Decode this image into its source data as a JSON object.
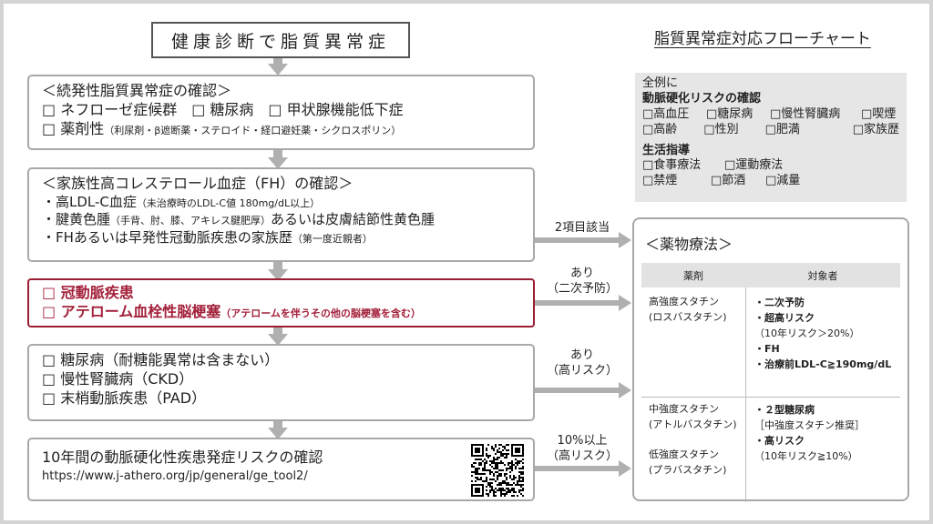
{
  "header": {
    "top_box": "健康診断で脂質異常症",
    "chart_title": "脂質異常症対応フローチャート"
  },
  "secondary": {
    "title": "＜続発性脂質異常症の確認＞",
    "line1": "□ ネフローゼ症候群　□ 糖尿病　□ 甲状腺機能低下症",
    "line2_main": "□ 薬剤性",
    "line2_note": "（利尿剤・β遮断薬・ステロイド・経口避妊薬・シクロスポリン）"
  },
  "fh": {
    "title": "＜家族性高コレステロール血症（FH）の確認＞",
    "l1_main": "・高LDL-C血症",
    "l1_note": "（未治療時のLDL-C値 180mg/dL以上）",
    "l2_a": "・腱黄色腫",
    "l2_note": "（手背、肘、膝、アキレス腱肥厚）",
    "l2_b": "あるいは皮膚結節性黄色腫",
    "l3_main": "・FHあるいは早発性冠動脈疾患の家族歴",
    "l3_note": "（第一度近親者）"
  },
  "cad": {
    "l1": "□ 冠動脈疾患",
    "l2_main": "□ アテローム血栓性脳梗塞",
    "l2_note": "（アテロームを伴うその他の脳梗塞を含む）"
  },
  "high_risk": {
    "l1": "□ 糖尿病（耐糖能異常は含まない）",
    "l2": "□ 慢性腎臓病（CKD）",
    "l3": "□ 末梢動脈疾患（PAD）"
  },
  "risk_calc": {
    "title": "10年間の動脈硬化性疾患発症リスクの確認",
    "url": "https://www.j-athero.org/jp/general/ge_tool2/"
  },
  "arrow_labels": {
    "fh": "2項目該当",
    "cad_1": "あり",
    "cad_2": "（二次予防）",
    "hr_1": "あり",
    "hr_2": "（高リスク）",
    "rc_1": "10%以上",
    "rc_2": "（高リスク）"
  },
  "all_cases": {
    "head": "全例に",
    "risk_title": "動脈硬化リスクの確認",
    "risk_row1": [
      "□高血圧",
      "□糖尿病",
      "□慢性腎臓病",
      "□喫煙"
    ],
    "risk_row2": [
      "□高齢",
      "□性別",
      "□肥満",
      "□家族歴"
    ],
    "life_title": "生活指導",
    "life_row1": [
      "□食事療法",
      "□運動療法"
    ],
    "life_row2": [
      "□禁煙",
      "□節酒",
      "□減量"
    ]
  },
  "drug": {
    "title": "＜薬物療法＞",
    "col_drug": "薬剤",
    "col_target": "対象者",
    "high_name1": "高強度スタチン",
    "high_name2": "(ロスバスタチン)",
    "high_t1": "・二次予防",
    "high_t2": "・超高リスク",
    "high_t3": "（10年リスク＞20%）",
    "high_t4": "・FH",
    "high_t5": "・治療前LDL-C≧190mg/dL",
    "mid_name1": "中強度スタチン",
    "mid_name2": "(アトルバスタチン)",
    "mid_t1": "・２型糖尿病",
    "mid_t2": "［中強度スタチン推奨］",
    "mid_t3": "・高リスク",
    "mid_t4": "（10年リスク≧10%）",
    "low_name1": "低強度スタチン",
    "low_name2": "(プラバスタチン)"
  },
  "colors": {
    "accent_red": "#a3203a",
    "arrow_gray": "#b0b0b0",
    "panel_gray": "#e6e6e6"
  },
  "icons": {
    "qr": "qr-code-icon"
  }
}
